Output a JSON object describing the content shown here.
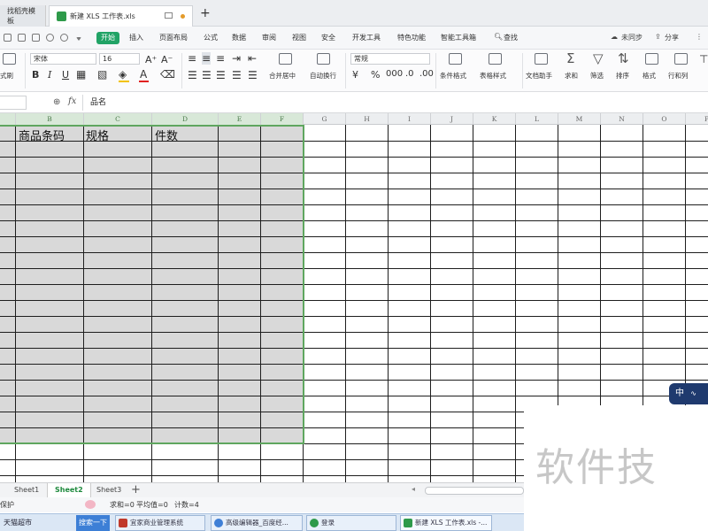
{
  "titlebar": {
    "tabs": [
      {
        "label": "找稻壳模板"
      },
      {
        "label": "新建 XLS 工作表.xls"
      }
    ],
    "new_tab": "+"
  },
  "menubar": {
    "items": [
      "开始",
      "插入",
      "页面布局",
      "公式",
      "数据",
      "审阅",
      "视图",
      "安全",
      "开发工具",
      "特色功能",
      "智能工具箱"
    ],
    "search": "查找",
    "sync": "未同步",
    "share": "分享"
  },
  "ribbon": {
    "paste_label": "式刷",
    "font_name": "宋体",
    "font_size": "16",
    "number_format": "常规",
    "labels": {
      "merge": "合并居中",
      "wrap": "自动换行",
      "cond_format": "条件格式",
      "table_style": "表格样式",
      "doc_helper": "文档助手",
      "sum": "求和",
      "filter": "筛选",
      "sort": "排序",
      "format": "格式",
      "rowcol": "行和列"
    },
    "colors": {
      "font_color_accent": "#e02020",
      "fill_accent": "#f2c200",
      "start_green": "#21a366"
    }
  },
  "formula_bar": {
    "fx": "fx",
    "content": "品名"
  },
  "grid": {
    "columns": [
      "B",
      "C",
      "D",
      "E",
      "F",
      "G",
      "H",
      "I",
      "J",
      "K",
      "L",
      "M",
      "N",
      "O",
      "P"
    ],
    "header_cells": [
      "商品条码",
      "规格",
      "件数"
    ]
  },
  "ime": {
    "label": "中"
  },
  "watermark": {
    "text": "软件技"
  },
  "sheets": {
    "tabs": [
      "Sheet1",
      "Sheet2",
      "Sheet3"
    ],
    "active": "Sheet2",
    "add": "+"
  },
  "statusbar": {
    "protect": "保护",
    "sum": "求和=0",
    "avg": "平均值=0",
    "count": "计数=4"
  },
  "taskbar": {
    "start": "天猫超市",
    "search": "搜索一下",
    "items": [
      {
        "label": "宜家商业管理系统",
        "color": "#c0392b"
      },
      {
        "label": "高级编辑器_百度经...",
        "color": "#3f7fd6"
      },
      {
        "label": "登录",
        "color": "#2e9a4a"
      },
      {
        "label": "新建 XLS 工作表.xls -...",
        "color": "#2e9a4a"
      }
    ]
  }
}
